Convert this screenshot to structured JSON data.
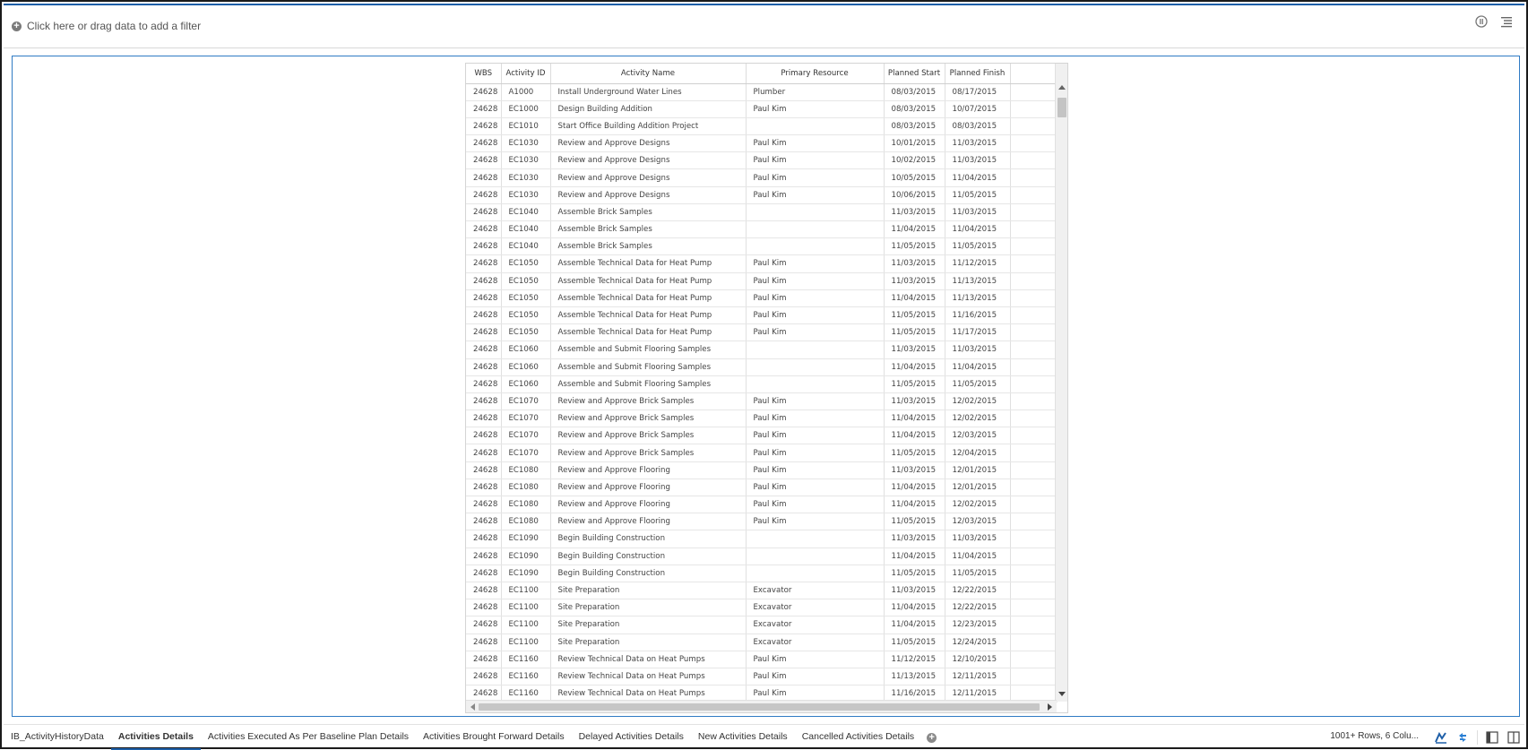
{
  "filter": {
    "label": "Click here or drag data to add a filter"
  },
  "toolbar": {
    "icons": [
      "info-icon",
      "menu-icon"
    ]
  },
  "table": {
    "columns": [
      "WBS",
      "Activity ID",
      "Activity Name",
      "Primary Resource",
      "Planned Start",
      "Planned Finish"
    ],
    "rows": [
      [
        "24628",
        "A1000",
        "Install Underground Water Lines",
        "Plumber",
        "08/03/2015",
        "08/17/2015"
      ],
      [
        "24628",
        "EC1000",
        "Design Building Addition",
        "Paul Kim",
        "08/03/2015",
        "10/07/2015"
      ],
      [
        "24628",
        "EC1010",
        "Start Office Building Addition Project",
        "",
        "08/03/2015",
        "08/03/2015"
      ],
      [
        "24628",
        "EC1030",
        "Review and Approve Designs",
        "Paul Kim",
        "10/01/2015",
        "11/03/2015"
      ],
      [
        "24628",
        "EC1030",
        "Review and Approve Designs",
        "Paul Kim",
        "10/02/2015",
        "11/03/2015"
      ],
      [
        "24628",
        "EC1030",
        "Review and Approve Designs",
        "Paul Kim",
        "10/05/2015",
        "11/04/2015"
      ],
      [
        "24628",
        "EC1030",
        "Review and Approve Designs",
        "Paul Kim",
        "10/06/2015",
        "11/05/2015"
      ],
      [
        "24628",
        "EC1040",
        "Assemble Brick Samples",
        "",
        "11/03/2015",
        "11/03/2015"
      ],
      [
        "24628",
        "EC1040",
        "Assemble Brick Samples",
        "",
        "11/04/2015",
        "11/04/2015"
      ],
      [
        "24628",
        "EC1040",
        "Assemble Brick Samples",
        "",
        "11/05/2015",
        "11/05/2015"
      ],
      [
        "24628",
        "EC1050",
        "Assemble Technical Data for Heat Pump",
        "Paul Kim",
        "11/03/2015",
        "11/12/2015"
      ],
      [
        "24628",
        "EC1050",
        "Assemble Technical Data for Heat Pump",
        "Paul Kim",
        "11/03/2015",
        "11/13/2015"
      ],
      [
        "24628",
        "EC1050",
        "Assemble Technical Data for Heat Pump",
        "Paul Kim",
        "11/04/2015",
        "11/13/2015"
      ],
      [
        "24628",
        "EC1050",
        "Assemble Technical Data for Heat Pump",
        "Paul Kim",
        "11/05/2015",
        "11/16/2015"
      ],
      [
        "24628",
        "EC1050",
        "Assemble Technical Data for Heat Pump",
        "Paul Kim",
        "11/05/2015",
        "11/17/2015"
      ],
      [
        "24628",
        "EC1060",
        "Assemble and Submit Flooring Samples",
        "",
        "11/03/2015",
        "11/03/2015"
      ],
      [
        "24628",
        "EC1060",
        "Assemble and Submit Flooring Samples",
        "",
        "11/04/2015",
        "11/04/2015"
      ],
      [
        "24628",
        "EC1060",
        "Assemble and Submit Flooring Samples",
        "",
        "11/05/2015",
        "11/05/2015"
      ],
      [
        "24628",
        "EC1070",
        "Review and Approve Brick Samples",
        "Paul Kim",
        "11/03/2015",
        "12/02/2015"
      ],
      [
        "24628",
        "EC1070",
        "Review and Approve Brick Samples",
        "Paul Kim",
        "11/04/2015",
        "12/02/2015"
      ],
      [
        "24628",
        "EC1070",
        "Review and Approve Brick Samples",
        "Paul Kim",
        "11/04/2015",
        "12/03/2015"
      ],
      [
        "24628",
        "EC1070",
        "Review and Approve Brick Samples",
        "Paul Kim",
        "11/05/2015",
        "12/04/2015"
      ],
      [
        "24628",
        "EC1080",
        "Review and Approve Flooring",
        "Paul Kim",
        "11/03/2015",
        "12/01/2015"
      ],
      [
        "24628",
        "EC1080",
        "Review and Approve Flooring",
        "Paul Kim",
        "11/04/2015",
        "12/01/2015"
      ],
      [
        "24628",
        "EC1080",
        "Review and Approve Flooring",
        "Paul Kim",
        "11/04/2015",
        "12/02/2015"
      ],
      [
        "24628",
        "EC1080",
        "Review and Approve Flooring",
        "Paul Kim",
        "11/05/2015",
        "12/03/2015"
      ],
      [
        "24628",
        "EC1090",
        "Begin Building Construction",
        "",
        "11/03/2015",
        "11/03/2015"
      ],
      [
        "24628",
        "EC1090",
        "Begin Building Construction",
        "",
        "11/04/2015",
        "11/04/2015"
      ],
      [
        "24628",
        "EC1090",
        "Begin Building Construction",
        "",
        "11/05/2015",
        "11/05/2015"
      ],
      [
        "24628",
        "EC1100",
        "Site Preparation",
        "Excavator",
        "11/03/2015",
        "12/22/2015"
      ],
      [
        "24628",
        "EC1100",
        "Site Preparation",
        "Excavator",
        "11/04/2015",
        "12/22/2015"
      ],
      [
        "24628",
        "EC1100",
        "Site Preparation",
        "Excavator",
        "11/04/2015",
        "12/23/2015"
      ],
      [
        "24628",
        "EC1100",
        "Site Preparation",
        "Excavator",
        "11/05/2015",
        "12/24/2015"
      ],
      [
        "24628",
        "EC1160",
        "Review Technical Data on Heat Pumps",
        "Paul Kim",
        "11/12/2015",
        "12/10/2015"
      ],
      [
        "24628",
        "EC1160",
        "Review Technical Data on Heat Pumps",
        "Paul Kim",
        "11/13/2015",
        "12/11/2015"
      ],
      [
        "24628",
        "EC1160",
        "Review Technical Data on Heat Pumps",
        "Paul Kim",
        "11/16/2015",
        "12/11/2015"
      ]
    ]
  },
  "tabs": [
    {
      "label": "IB_ActivityHistoryData",
      "active": false
    },
    {
      "label": "Activities Details",
      "active": true
    },
    {
      "label": "Activities Executed As Per Baseline Plan Details",
      "active": false
    },
    {
      "label": "Activities Brought Forward Details",
      "active": false
    },
    {
      "label": "Delayed Activities Details",
      "active": false
    },
    {
      "label": "New Activities Details",
      "active": false
    },
    {
      "label": "Cancelled Activities Details",
      "active": false
    }
  ],
  "status": {
    "text": "1001+ Rows, 6 Colu..."
  },
  "bottom_icons": [
    "visualize-icon",
    "refresh-icon",
    "left-panel-icon",
    "split-panel-icon"
  ],
  "colors": {
    "accent": "#1e5fa8",
    "panel_border": "#2f7bc4"
  }
}
